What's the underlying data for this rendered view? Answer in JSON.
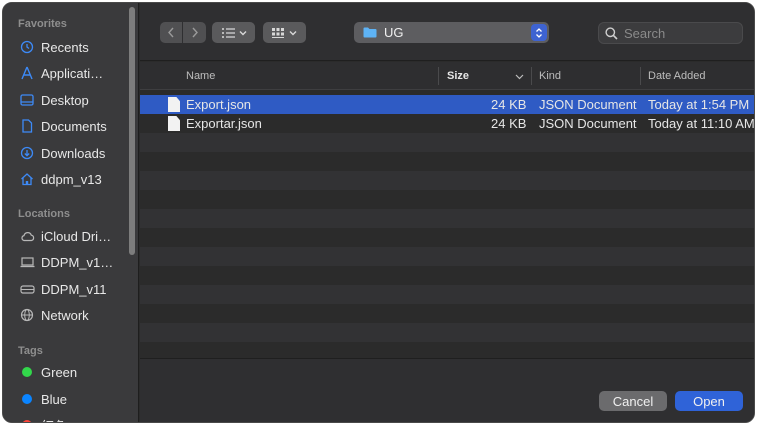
{
  "sidebar": {
    "favorites_title": "Favorites",
    "favorites": [
      {
        "label": "Recents",
        "icon": "clock-icon"
      },
      {
        "label": "Applicati…",
        "icon": "applications-icon"
      },
      {
        "label": "Desktop",
        "icon": "desktop-icon"
      },
      {
        "label": "Documents",
        "icon": "document-icon"
      },
      {
        "label": "Downloads",
        "icon": "download-icon"
      },
      {
        "label": "ddpm_v13",
        "icon": "home-icon"
      }
    ],
    "locations_title": "Locations",
    "locations": [
      {
        "label": "iCloud Dri…",
        "icon": "cloud-icon"
      },
      {
        "label": "DDPM_v1…",
        "icon": "laptop-icon"
      },
      {
        "label": "DDPM_v11",
        "icon": "drive-icon"
      },
      {
        "label": "Network",
        "icon": "globe-icon"
      }
    ],
    "tags_title": "Tags",
    "tags": [
      {
        "label": "Green",
        "color": "#32d74b"
      },
      {
        "label": "Blue",
        "color": "#0a84ff"
      },
      {
        "label": "红色",
        "color": "#ff453a"
      }
    ]
  },
  "toolbar": {
    "folder_name": "UG",
    "search_placeholder": "Search"
  },
  "columns": {
    "name": "Name",
    "size": "Size",
    "kind": "Kind",
    "date": "Date Added"
  },
  "files": [
    {
      "name": "Export.json",
      "size": "24 KB",
      "kind": "JSON Document",
      "date": "Today at 1:54 PM",
      "selected": true
    },
    {
      "name": "Exportar.json",
      "size": "24 KB",
      "kind": "JSON Document",
      "date": "Today at 11:10 AM",
      "selected": false
    }
  ],
  "buttons": {
    "cancel": "Cancel",
    "open": "Open"
  },
  "colors": {
    "accent": "#2f63d8",
    "selection": "#2f5bc4",
    "sidebar_bg": "#3a3a3c"
  }
}
